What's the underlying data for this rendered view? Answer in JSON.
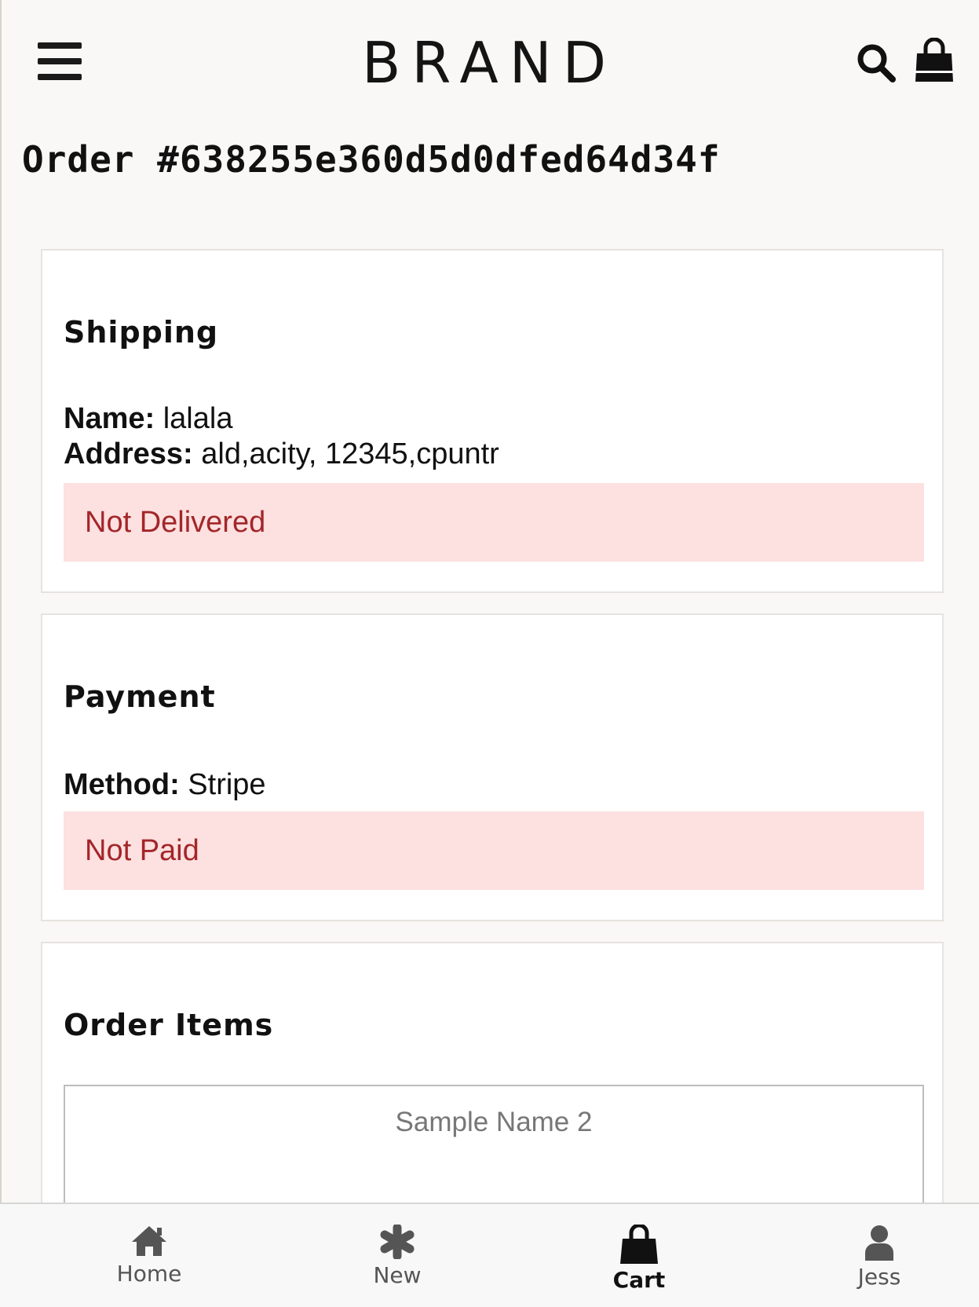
{
  "header": {
    "brand": "BRAND",
    "menu_icon": "hamburger-menu-icon",
    "search_icon": "search-icon",
    "bag_icon": "shopping-bag-icon"
  },
  "order": {
    "title": "Order #638255e360d5d0dfed64d34f"
  },
  "shipping": {
    "heading": "Shipping",
    "name_label": "Name:",
    "name_value": "lalala",
    "address_label": "Address:",
    "address_value": "ald,acity, 12345,cpuntr",
    "status": "Not Delivered"
  },
  "payment": {
    "heading": "Payment",
    "method_label": "Method:",
    "method_value": "Stripe",
    "status": "Not Paid"
  },
  "order_items": {
    "heading": "Order Items",
    "items": [
      {
        "name": "Sample Name 2"
      }
    ]
  },
  "bottom_nav": {
    "items": [
      {
        "label": "Home",
        "icon": "home-icon"
      },
      {
        "label": "New",
        "icon": "asterisk-icon"
      },
      {
        "label": "Cart",
        "icon": "shopping-bag-icon",
        "active": true
      },
      {
        "label": "Jess",
        "icon": "user-icon"
      }
    ]
  },
  "colors": {
    "background": "#f9f8f6",
    "alert_bg": "#fde0e0",
    "alert_text": "#a3262a"
  }
}
